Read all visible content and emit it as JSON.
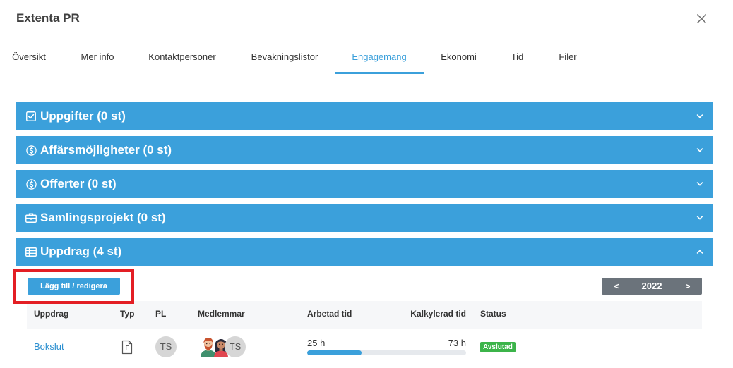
{
  "dialog": {
    "title": "Extenta PR",
    "close_icon": "close-icon"
  },
  "tabs": [
    {
      "label": "Översikt",
      "active": false
    },
    {
      "label": "Mer info",
      "active": false
    },
    {
      "label": "Kontaktpersoner",
      "active": false
    },
    {
      "label": "Bevakningslistor",
      "active": false
    },
    {
      "label": "Engagemang",
      "active": true
    },
    {
      "label": "Ekonomi",
      "active": false
    },
    {
      "label": "Tid",
      "active": false
    },
    {
      "label": "Filer",
      "active": false
    }
  ],
  "sections": [
    {
      "label": "Uppgifter (0 st)",
      "icon": "check-square-icon",
      "expanded": false
    },
    {
      "label": "Affärsmöjligheter (0 st)",
      "icon": "dollar-circle-icon",
      "expanded": false
    },
    {
      "label": "Offerter (0 st)",
      "icon": "dollar-circle-icon",
      "expanded": false
    },
    {
      "label": "Samlingsprojekt (0 st)",
      "icon": "briefcase-icon",
      "expanded": false
    },
    {
      "label": "Uppdrag (4 st)",
      "icon": "table-icon",
      "expanded": true
    }
  ],
  "uppdrag": {
    "add_button_label": "Lägg till / redigera",
    "year_nav": {
      "prev_label": "<",
      "year": "2022",
      "next_label": ">"
    },
    "columns": {
      "name": "Uppdrag",
      "type": "Typ",
      "pl": "PL",
      "members": "Medlemmar",
      "worked": "Arbetad tid",
      "calculated": "Kalkylerad tid",
      "status": "Status"
    },
    "rows": [
      {
        "name": "Bokslut",
        "type_icon": "document-icon",
        "type_label": "F",
        "pl_initials": "TS",
        "members": [
          {
            "icon": "man-avatar-icon"
          },
          {
            "icon": "woman-avatar-icon"
          },
          {
            "initials": "TS"
          }
        ],
        "worked": "25 h",
        "calculated": "73 h",
        "worked_progress": 0.34,
        "status": "Avslutad"
      }
    ]
  },
  "colors": {
    "accent": "#3ba0db",
    "link": "#2b8fd0",
    "status_done": "#3cb44a",
    "year_nav_bg": "#6b737b",
    "highlight_box": "#e31e24"
  }
}
